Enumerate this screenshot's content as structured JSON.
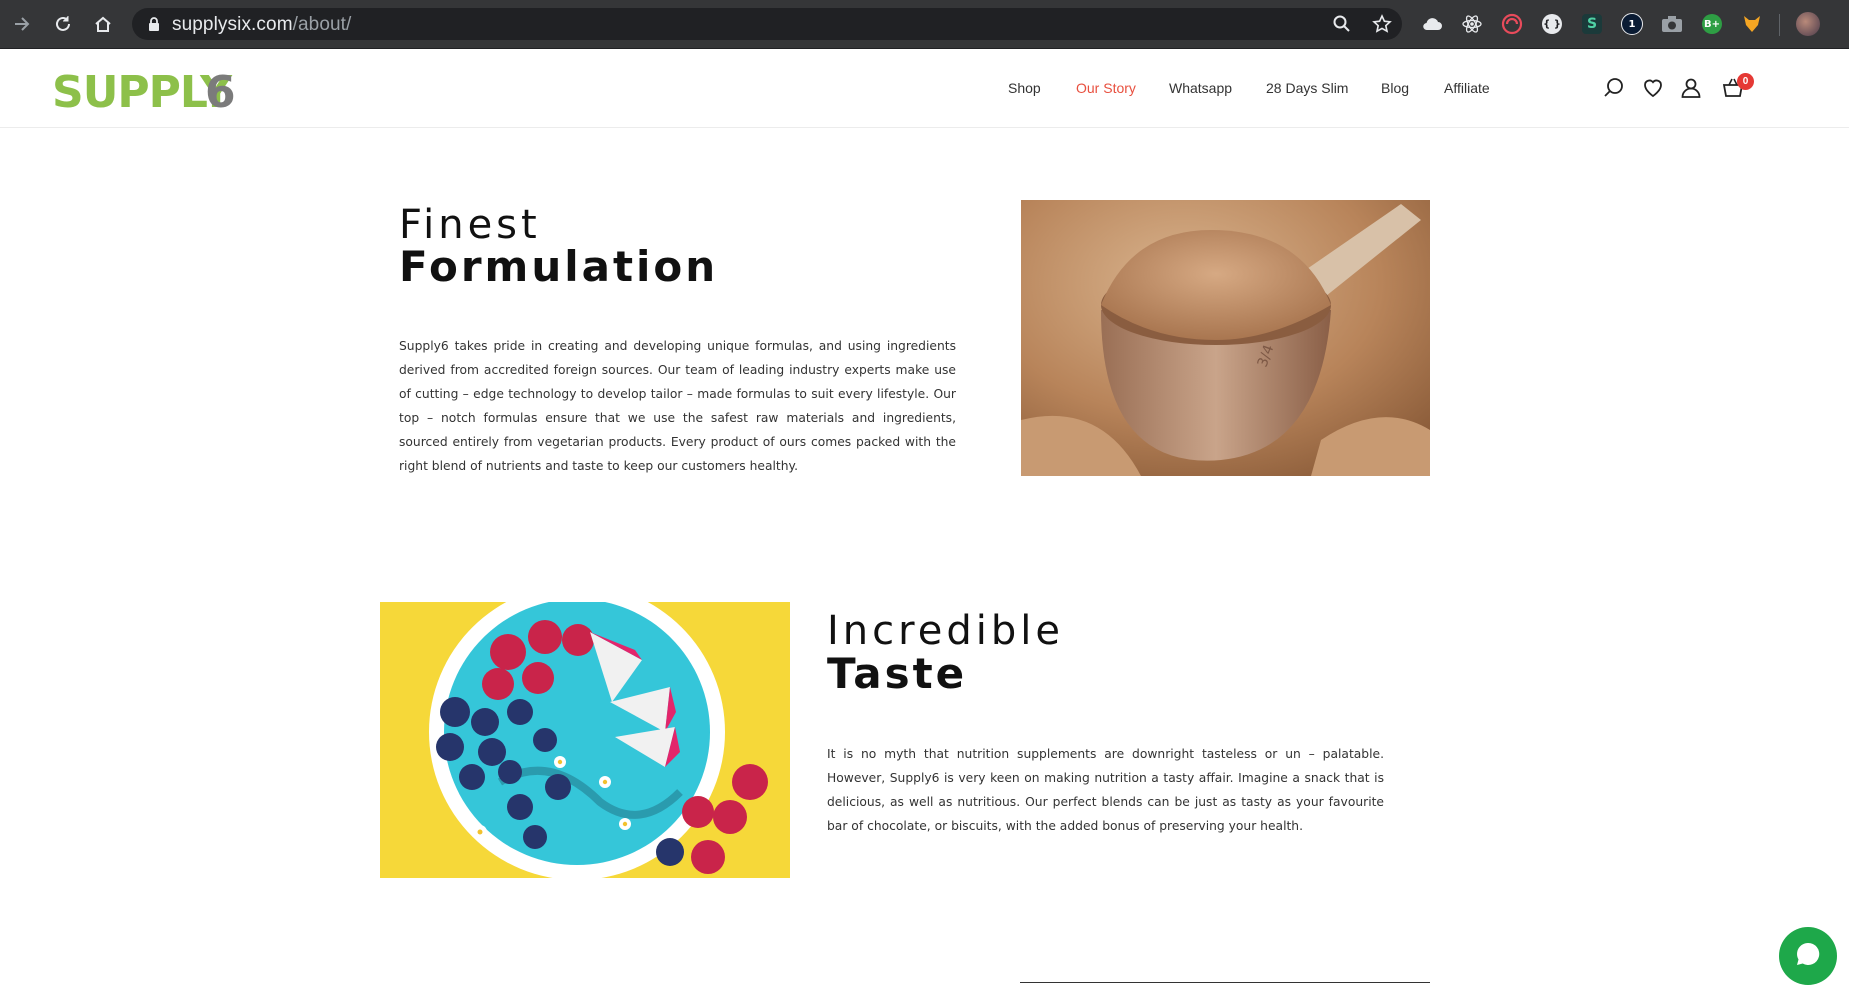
{
  "browser": {
    "url_domain": "supplysix.com",
    "url_path": "/about/",
    "extensions": [
      "cloud-icon",
      "react-icon",
      "swirl-icon",
      "bracket-icon",
      "s-icon",
      "one-icon",
      "camera-icon",
      "b-plus-icon",
      "fox-icon",
      "avatar"
    ]
  },
  "site": {
    "logo_text": "SUPPLY6",
    "logo_colors": {
      "green": "#8dc04a",
      "gray": "#7b7b7b"
    },
    "nav": {
      "shop": "Shop",
      "our_story": "Our Story",
      "whatsapp": "Whatsapp",
      "slim": "28 Days Slim",
      "blog": "Blog",
      "affiliate": "Affiliate"
    },
    "cart_count": "0",
    "accent_color": "#e8503f"
  },
  "section1": {
    "heading_light": "Finest",
    "heading_bold": "Formulation",
    "body": "Supply6 takes pride in creating and developing unique formulas, and using ingredients derived from accredited foreign sources. Our team of leading industry experts make use of cutting – edge technology to develop tailor – made formulas to suit every lifestyle. Our top – notch formulas ensure that we use the safest raw materials and ingredients, sourced entirely from vegetarian products. Every product of ours comes packed with the right blend of nutrients and taste to keep our customers healthy."
  },
  "section2": {
    "heading_light": "Incredible",
    "heading_bold": "Taste",
    "body": "It is no myth that nutrition supplements are downright tasteless or un – palatable. However, Supply6 is very keen on making nutrition a tasty affair. Imagine a snack that is delicious, as well as nutritious. Our perfect blends can be just as tasty as your favourite bar of chocolate, or biscuits, with the added bonus of preserving your health."
  }
}
